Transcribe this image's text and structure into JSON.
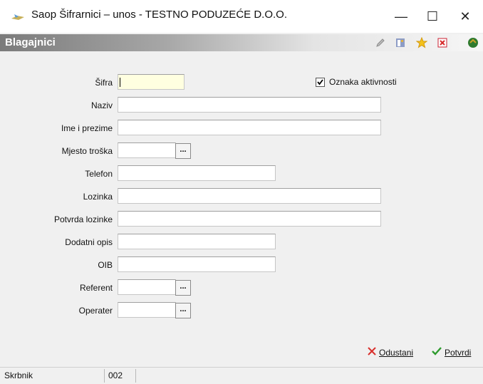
{
  "window": {
    "title": "Saop Šifrarnici – unos - TESTNO PODUZEĆE D.O.O.",
    "minimize": "—",
    "maximize": "☐",
    "close": "✕"
  },
  "header": {
    "title": "Blagajnici",
    "tools": [
      "edit-icon",
      "layout-icon",
      "star-icon",
      "delete-icon",
      "green-shape-icon"
    ]
  },
  "form": {
    "sifra": {
      "label": "Šifra",
      "value": ""
    },
    "oznaka_aktivnosti": {
      "label": "Oznaka aktivnosti",
      "checked": true
    },
    "naziv": {
      "label": "Naziv",
      "value": ""
    },
    "ime_prezime": {
      "label": "Ime i prezime",
      "value": ""
    },
    "mjesto_troska": {
      "label": "Mjesto troška",
      "value": "",
      "button": "..."
    },
    "telefon": {
      "label": "Telefon",
      "value": ""
    },
    "lozinka": {
      "label": "Lozinka",
      "value": ""
    },
    "potvrda_lozinke": {
      "label": "Potvrda lozinke",
      "value": ""
    },
    "dodatni_opis": {
      "label": "Dodatni opis",
      "value": ""
    },
    "oib": {
      "label": "OIB",
      "value": ""
    },
    "referent": {
      "label": "Referent",
      "value": "",
      "button": "..."
    },
    "operater": {
      "label": "Operater",
      "value": "",
      "button": "..."
    }
  },
  "actions": {
    "cancel": "Odustani",
    "confirm": "Potvrdi"
  },
  "status": {
    "user": "Skrbnik",
    "code": "002",
    "message": ""
  },
  "colors": {
    "cancel_icon": "#d9302c",
    "confirm_icon": "#2e9b2e",
    "active_field": "#ffffe0"
  }
}
